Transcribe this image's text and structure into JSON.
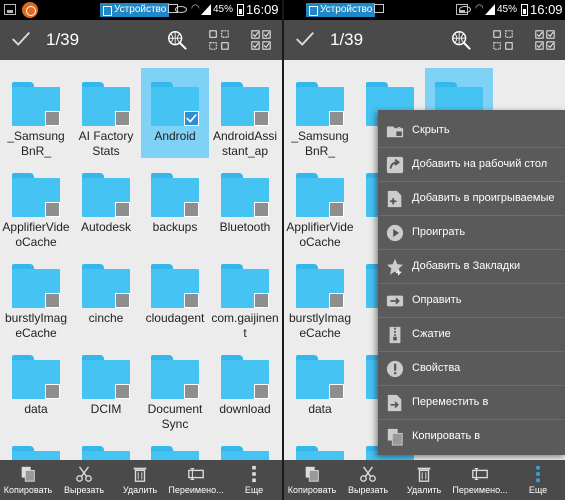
{
  "status": {
    "device_label": "Устройство",
    "battery": "45%",
    "time": "16:09"
  },
  "toolbar": {
    "selection_count": "1/39"
  },
  "folders": [
    {
      "name": "_Samsung BnR_",
      "selected": false
    },
    {
      "name": "AI Factory Stats",
      "selected": false
    },
    {
      "name": "Android",
      "selected": true
    },
    {
      "name": "AndroidAssistant_ap",
      "selected": false
    },
    {
      "name": "ApplifierVideoCache",
      "selected": false
    },
    {
      "name": "Autodesk",
      "selected": false
    },
    {
      "name": "backups",
      "selected": false
    },
    {
      "name": "Bluetooth",
      "selected": false
    },
    {
      "name": "burstlyImageCache",
      "selected": false
    },
    {
      "name": "cinche",
      "selected": false
    },
    {
      "name": "cloudagent",
      "selected": false
    },
    {
      "name": "com.gaijinent",
      "selected": false
    },
    {
      "name": "data",
      "selected": false
    },
    {
      "name": "DCIM",
      "selected": false
    },
    {
      "name": "Document Sync",
      "selected": false
    },
    {
      "name": "download",
      "selected": false
    }
  ],
  "right_folders": [
    {
      "name": "_Samsung BnR_"
    },
    {
      "name": "AI"
    },
    {
      "name": "ApplifierVideoCache"
    },
    {
      "name": "Au"
    },
    {
      "name": "burstlyImageCache"
    },
    {
      "name": "ci"
    },
    {
      "name": "data"
    },
    {
      "name": "D"
    }
  ],
  "bottombar": {
    "copy": "Копировать",
    "cut": "Вырезать",
    "delete": "Удалить",
    "rename": "Переимено...",
    "more": "Еще"
  },
  "menu": [
    {
      "label": "Скрыть",
      "icon": "hide-icon"
    },
    {
      "label": "Добавить на рабочий стол",
      "icon": "add-to-desktop-icon"
    },
    {
      "label": "Добавить в проигрываемые",
      "icon": "add-to-playlist-icon"
    },
    {
      "label": "Проиграть",
      "icon": "play-icon"
    },
    {
      "label": "Добавить в Закладки",
      "icon": "bookmark-icon"
    },
    {
      "label": "Оправить",
      "icon": "send-icon"
    },
    {
      "label": "Сжатие",
      "icon": "compress-icon"
    },
    {
      "label": "Свойства",
      "icon": "properties-icon"
    },
    {
      "label": "Переместить в",
      "icon": "move-to-icon"
    },
    {
      "label": "Копировать в",
      "icon": "copy-to-icon"
    }
  ],
  "colors": {
    "folder": "#45c3f3",
    "selected_bg": "#7fd1f5",
    "toolbar": "#4a4a4a",
    "accent": "#2b8ed6",
    "device_badge": "#1e88c9"
  }
}
